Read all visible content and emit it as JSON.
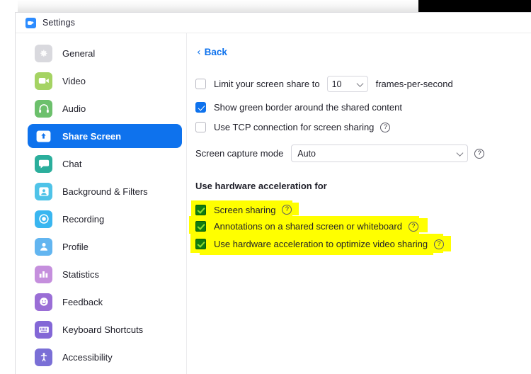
{
  "window": {
    "title": "Settings",
    "app_icon": "zoom-camera-icon"
  },
  "sidebar": {
    "items": [
      {
        "label": "General",
        "icon": "gear-icon",
        "color": "#d9d9de",
        "selected": false
      },
      {
        "label": "Video",
        "icon": "video-camera-icon",
        "color": "#a5d363",
        "selected": false
      },
      {
        "label": "Audio",
        "icon": "headphones-icon",
        "color": "#6cc06c",
        "selected": false
      },
      {
        "label": "Share Screen",
        "icon": "share-screen-up-arrow-icon",
        "color": "#0e72ed",
        "selected": true
      },
      {
        "label": "Chat",
        "icon": "chat-bubble-icon",
        "color": "#2bae9c",
        "selected": false
      },
      {
        "label": "Background & Filters",
        "icon": "person-frame-icon",
        "color": "#4fc3e8",
        "selected": false
      },
      {
        "label": "Recording",
        "icon": "record-circle-icon",
        "color": "#39b6f0",
        "selected": false
      },
      {
        "label": "Profile",
        "icon": "person-icon",
        "color": "#62b5f0",
        "selected": false
      },
      {
        "label": "Statistics",
        "icon": "bar-chart-icon",
        "color": "#c58fdd",
        "selected": false
      },
      {
        "label": "Feedback",
        "icon": "smiley-face-icon",
        "color": "#9a6ed6",
        "selected": false
      },
      {
        "label": "Keyboard Shortcuts",
        "icon": "keyboard-icon",
        "color": "#8367d6",
        "selected": false
      },
      {
        "label": "Accessibility",
        "icon": "accessibility-person-icon",
        "color": "#7a6fd6",
        "selected": false
      }
    ]
  },
  "main": {
    "back_label": "Back",
    "back_chevron": "‹",
    "limit_share": {
      "label": "Limit your screen share to",
      "checked": false,
      "fps_value": "10",
      "suffix": "frames-per-second"
    },
    "green_border": {
      "label": "Show green border around the shared content",
      "checked": true
    },
    "tcp_connection": {
      "label": "Use TCP connection for screen sharing",
      "checked": false,
      "help": "?"
    },
    "capture_mode": {
      "label": "Screen capture mode",
      "value": "Auto",
      "help": "?"
    },
    "hardware_section": {
      "title": "Use hardware acceleration for",
      "options": [
        {
          "label": "Screen sharing",
          "checked": true,
          "help": "?",
          "highlighted": true
        },
        {
          "label": "Annotations on a shared screen or whiteboard",
          "checked": true,
          "help": "?",
          "highlighted": true
        },
        {
          "label": "Use hardware acceleration to optimize video sharing",
          "checked": true,
          "help": "?",
          "highlighted": true
        }
      ]
    }
  },
  "colors": {
    "accent": "#0e72ed",
    "highlight": "#ffff00",
    "checked_green": "#107c10",
    "check_glyph_green": "#8ddc2e"
  }
}
